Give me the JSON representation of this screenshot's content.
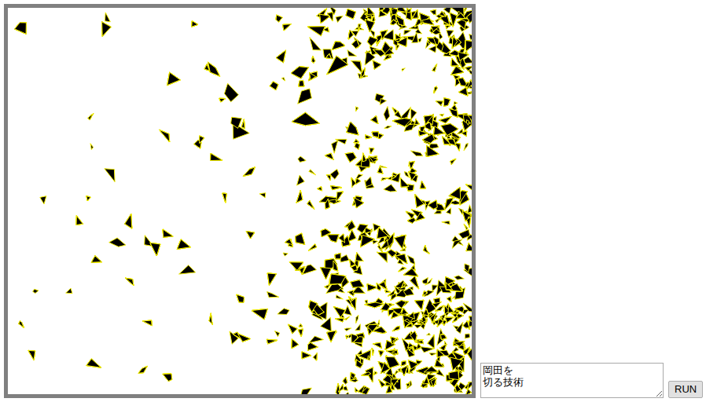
{
  "editor": {
    "value": "岡田を\n切る技術"
  },
  "buttons": [
    "RUN"
  ]
}
